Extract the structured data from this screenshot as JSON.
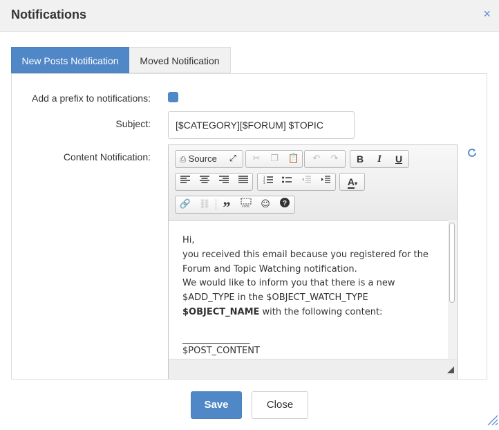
{
  "dialog": {
    "title": "Notifications",
    "close_icon": "×"
  },
  "tabs": [
    {
      "label": "New Posts Notification",
      "active": true
    },
    {
      "label": "Moved Notification",
      "active": false
    }
  ],
  "form": {
    "prefix_label": "Add a prefix to notifications:",
    "prefix_checked": true,
    "subject_label": "Subject:",
    "subject_value": "[$CATEGORY][$FORUM] $TOPIC",
    "content_label": "Content Notification:"
  },
  "editor": {
    "source_label": "Source",
    "content_lines": [
      "Hi,",
      "you received this email because you registered for the",
      "Forum and Topic Watching notification.",
      "We would like to inform you that there is a new",
      "$ADD_TYPE in the $OBJECT_WATCH_TYPE"
    ],
    "bold_name": "$OBJECT_NAME",
    "after_bold": " with the following content:",
    "separator": "_______________",
    "post_content": "$POST_CONTENT"
  },
  "footer": {
    "save_label": "Save",
    "close_label": "Close"
  },
  "colors": {
    "accent": "#5087c7",
    "header_bg": "#f1f1f1"
  }
}
